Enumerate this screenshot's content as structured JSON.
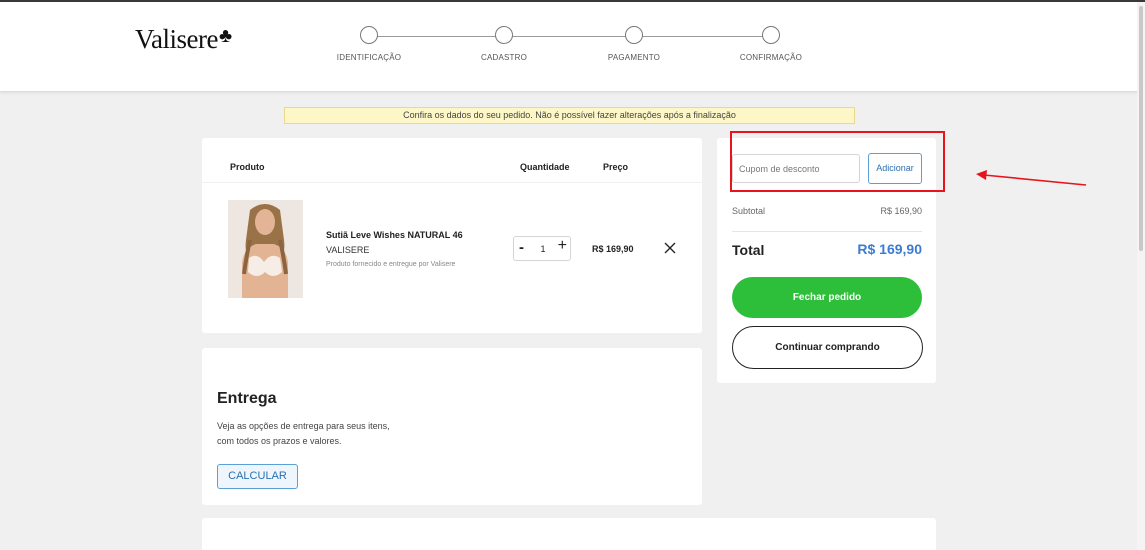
{
  "header": {
    "logo_text": "Valisere",
    "steps": [
      {
        "label": "IDENTIFICAÇÃO"
      },
      {
        "label": "CADASTRO"
      },
      {
        "label": "PAGAMENTO"
      },
      {
        "label": "CONFIRMAÇÃO"
      }
    ]
  },
  "notice": "Confira os dados do seu pedido. Não é possível fazer alterações após a finalização",
  "cart": {
    "columns": {
      "product": "Produto",
      "quantity": "Quantidade",
      "price": "Preço"
    },
    "items": [
      {
        "name": "Sutiã Leve Wishes NATURAL 46",
        "brand": "VALISERE",
        "note": "Produto fornecido e entregue por Valisere",
        "quantity": "1",
        "minus_label": "-",
        "plus_label": "+",
        "price": "R$ 169,90"
      }
    ]
  },
  "delivery": {
    "title": "Entrega",
    "text_line1": "Veja as opções de entrega para seus itens,",
    "text_line2": "com todos os prazos e valores.",
    "button_label": "CALCULAR"
  },
  "summary": {
    "coupon_placeholder": "Cupom de desconto",
    "coupon_button": "Adicionar",
    "subtotal_label": "Subtotal",
    "subtotal_value": "R$ 169,90",
    "total_label": "Total",
    "total_value": "R$ 169,90",
    "checkout_button": "Fechar pedido",
    "continue_button": "Continuar comprando"
  },
  "colors": {
    "accent_green": "#2ebf3a",
    "accent_blue": "#3a7bd5",
    "annotation_red": "#e8141c"
  },
  "icons": [
    "club-icon",
    "close-icon",
    "product-thumbnail",
    "annotation-arrow"
  ]
}
